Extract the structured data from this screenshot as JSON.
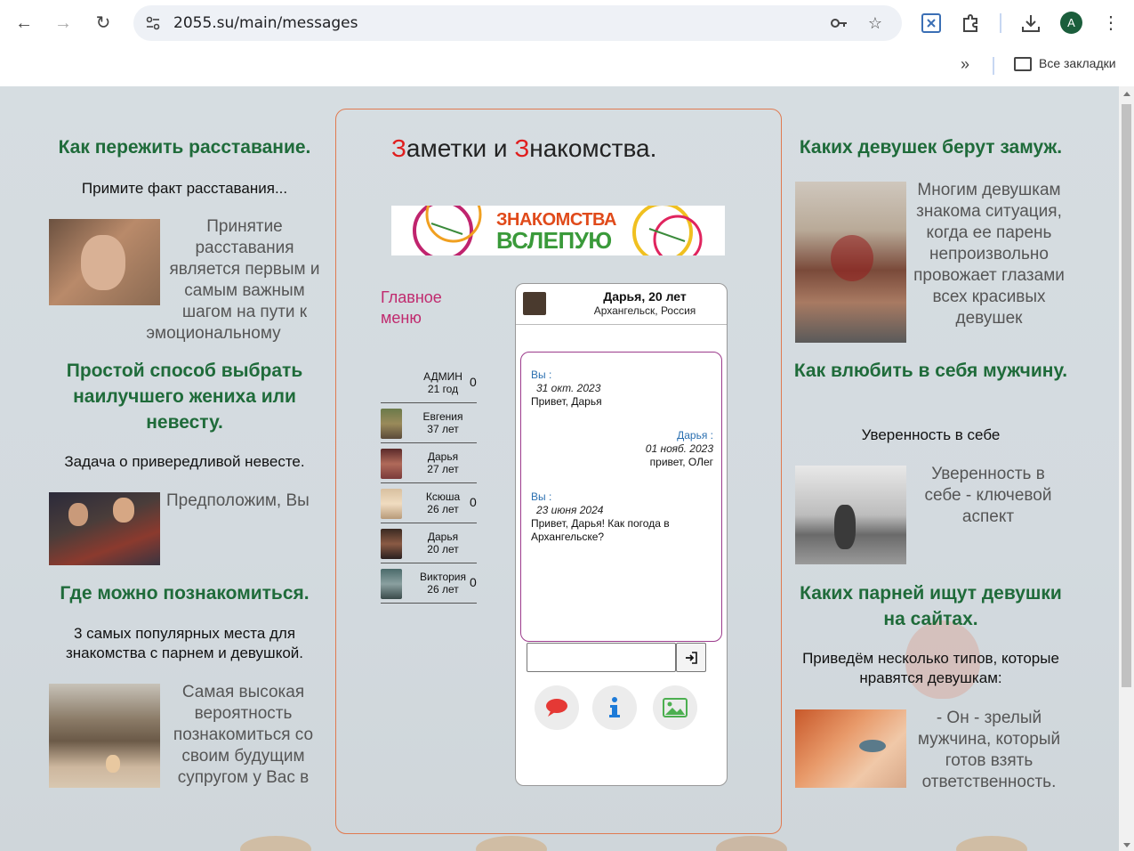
{
  "browser": {
    "url": "2055.su/main/messages",
    "avatar_letter": "A",
    "bookmarks_label": "Все закладки"
  },
  "site": {
    "title_first_letter": "З",
    "title_part1": "аметки и ",
    "title_second_letter": "З",
    "title_part2": "накомства.",
    "banner_line1": "ЗНАКОМСТВА",
    "banner_line2": "ВСЛЕПУЮ",
    "main_menu_line1": "Главное",
    "main_menu_line2": "меню"
  },
  "left_articles": [
    {
      "title": "Как пережить расставание.",
      "subtitle": "Примите факт расставания...",
      "body": "Принятие расставания является первым и самым важным шагом на пути к эмоциональному"
    },
    {
      "title": "Простой способ выбрать наилучшего жениха или невесту.",
      "subtitle": "Задача о привередливой невесте.",
      "body": "Предположим, Вы"
    },
    {
      "title": "Где можно познакомиться.",
      "subtitle": "3 самых популярных места для знакомства с парнем и девушкой.",
      "body": "Самая высокая вероятность познакомиться со своим будущим супругом у Вас в"
    }
  ],
  "right_articles": [
    {
      "title": "Каких девушек берут замуж.",
      "body": "Многим девушкам знакома ситуация, когда ее парень непроизвольно провожает глазами всех красивых девушек"
    },
    {
      "title": "Как влюбить в себя мужчину.",
      "subtitle": "Уверенность в себе",
      "body": "Уверенность в себе - ключевой аспект"
    },
    {
      "title": "Каких парней ищут девушки на сайтах.",
      "subtitle": "Приведём несколько типов, которые нравятся девушкам:",
      "body": "- Он - зрелый мужчина, который готов взять ответственность."
    }
  ],
  "contacts": [
    {
      "name": "АДМИН",
      "age": "21 год",
      "count": "0"
    },
    {
      "name": "Евгения",
      "age": "37 лет",
      "count": ""
    },
    {
      "name": "Дарья",
      "age": "27 лет",
      "count": ""
    },
    {
      "name": "Ксюша",
      "age": "26 лет",
      "count": "0"
    },
    {
      "name": "Дарья",
      "age": "20 лет",
      "count": ""
    },
    {
      "name": "Виктория",
      "age": "26 лет",
      "count": "0"
    }
  ],
  "chat": {
    "partner_name": "Дарья, 20 лет",
    "partner_city": "Архангельск, Россия",
    "messages": [
      {
        "who": "Вы :",
        "date": "31 окт. 2023",
        "text": "Привет, Дарья"
      },
      {
        "who": "Дарья :",
        "date": "01 нояб. 2023",
        "text": "привет, ОЛег"
      },
      {
        "who": "Вы :",
        "date": "23 июня 2024",
        "text": "Привет, Дарья! Как погода в Архангельске?"
      }
    ],
    "send_icon": "sign-in-icon",
    "actions": [
      "speech-bubble-icon",
      "info-icon",
      "image-icon"
    ]
  },
  "colors": {
    "title_green": "#1f6b3a",
    "accent_red": "#e01d1d",
    "menu_pink": "#c02a6e",
    "panel_border": "#e07a50",
    "message_border": "#9c3b8c",
    "sender_blue": "#2a6fb0"
  }
}
